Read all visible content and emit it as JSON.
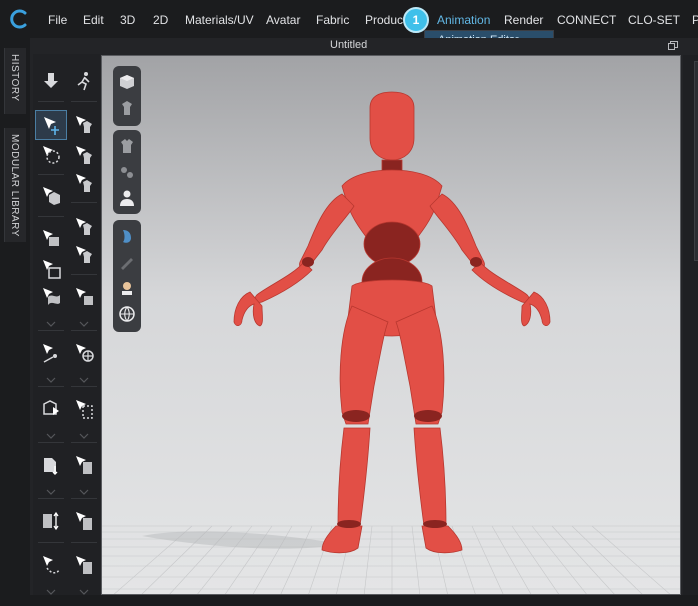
{
  "menubar": {
    "items": [
      {
        "label": "File"
      },
      {
        "label": "Edit"
      },
      {
        "label": "3D"
      },
      {
        "label": "2D"
      },
      {
        "label": "Materials/UV"
      },
      {
        "label": "Avatar"
      },
      {
        "label": "Fabric"
      },
      {
        "label": "Product"
      },
      {
        "label": "Animation"
      },
      {
        "label": "Render"
      },
      {
        "label": "CONNECT"
      },
      {
        "label": "CLO-SET"
      },
      {
        "label": "P"
      }
    ],
    "active_label": "Animation",
    "active_color": "#62b8e6"
  },
  "step_badge": {
    "number": "1",
    "color": "#3fc0ea"
  },
  "submenu": {
    "items": [
      {
        "label": "Animation Editor"
      }
    ]
  },
  "document": {
    "title": "Untitled"
  },
  "side_tabs": [
    {
      "label": "HISTORY"
    },
    {
      "label": "MODULAR LIBRARY"
    }
  ],
  "toolbar_icons": {
    "left": [
      "arrow-down-icon",
      "select-move-icon",
      "transform-pattern-icon",
      "select-mesh-icon",
      "fold-arrangement-icon",
      "pin-icon",
      "tack-icon",
      "strap-icon",
      "fabric-adjust-icon",
      "measure-icon",
      "sewing-line-icon",
      "avatar-fit-icon",
      "avatar-measure-icon",
      "zipper-icon"
    ],
    "right": [
      "walk-pose-icon",
      "garment-fit-icon",
      "arrangement-icon",
      "attach-icon",
      "elastic-icon",
      "tape-icon",
      "pose-point-icon",
      "x-ray-joint-icon",
      "fixed-pin-icon",
      "layer-icon",
      "fold-icon",
      "button-icon",
      "crop-icon",
      "mesh-reduce-icon"
    ]
  },
  "viewport_icons": [
    "cube-display-icon",
    "avatar-display-icon",
    "garment-icon",
    "fabric-icon",
    "avatar-icon",
    "skin-icon",
    "needle-icon",
    "texture-icon",
    "globe-icon"
  ],
  "avatar": {
    "color": "#e24f46",
    "joint_color": "#8a2420"
  }
}
